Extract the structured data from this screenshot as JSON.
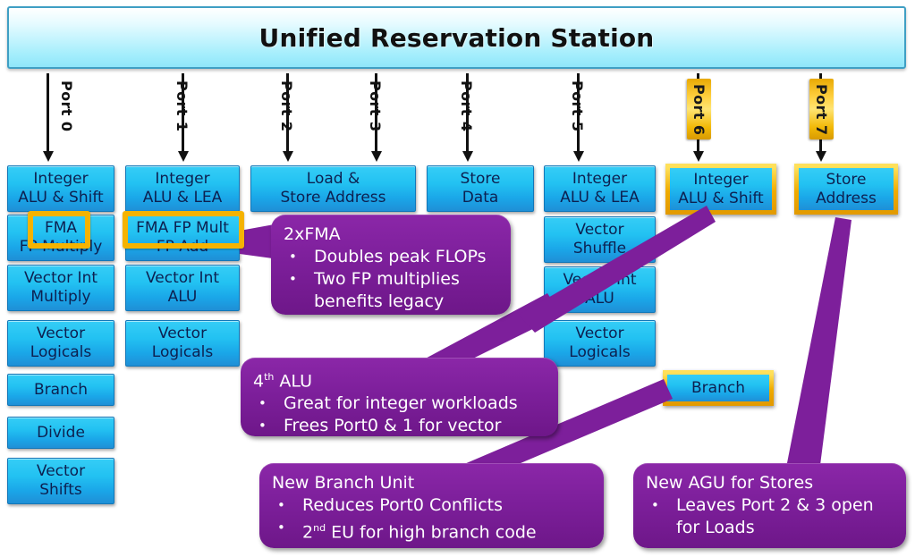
{
  "header": {
    "title": "Unified Reservation Station"
  },
  "ports": [
    {
      "label": "Port 0",
      "highlight": false
    },
    {
      "label": "Port 1",
      "highlight": false
    },
    {
      "label": "Port 2",
      "highlight": false
    },
    {
      "label": "Port 3",
      "highlight": false
    },
    {
      "label": "Port 4",
      "highlight": false
    },
    {
      "label": "Port 5",
      "highlight": false
    },
    {
      "label": "Port 6",
      "highlight": true
    },
    {
      "label": "Port 7",
      "highlight": true
    }
  ],
  "units": {
    "p0": [
      {
        "line1": "Integer",
        "line2": "ALU & Shift"
      },
      {
        "line1": "FMA",
        "line2": "FP Multiply"
      },
      {
        "line1": "Vector Int",
        "line2": "Multiply"
      },
      {
        "line1": "Vector",
        "line2": "Logicals"
      },
      {
        "line1": "Branch",
        "line2": ""
      },
      {
        "line1": "Divide",
        "line2": ""
      },
      {
        "line1": "Vector",
        "line2": "Shifts"
      }
    ],
    "p1": [
      {
        "line1": "Integer",
        "line2": "ALU & LEA"
      },
      {
        "line1": "FMA FP Mult",
        "line2": "FP Add"
      },
      {
        "line1": "Vector Int",
        "line2": "ALU"
      },
      {
        "line1": "Vector",
        "line2": "Logicals"
      }
    ],
    "p23": [
      {
        "line1": "Load &",
        "line2": "Store Address"
      }
    ],
    "p4": [
      {
        "line1": "Store",
        "line2": "Data"
      }
    ],
    "p5": [
      {
        "line1": "Integer",
        "line2": "ALU & LEA"
      },
      {
        "line1": "Vector",
        "line2": "Shuffle"
      },
      {
        "line1": "Vector Int",
        "line2": "ALU"
      },
      {
        "line1": "Vector",
        "line2": "Logicals"
      }
    ],
    "p6": [
      {
        "line1": "Integer",
        "line2": "ALU & Shift"
      },
      {
        "line1": "Branch",
        "line2": ""
      }
    ],
    "p7": [
      {
        "line1": "Store",
        "line2": "Address"
      }
    ]
  },
  "callouts": {
    "fma": {
      "title": "2xFMA",
      "bullets": [
        "Doubles peak FLOPs",
        "Two FP multiplies benefits legacy"
      ],
      "bullet_char": "•"
    },
    "alu": {
      "title_main": "4",
      "title_sup": "th",
      "title_rest": " ALU",
      "bullets": [
        "Great for integer workloads",
        "Frees Port0 & 1 for vector"
      ],
      "bullet_char": "•"
    },
    "branch": {
      "title": "New Branch Unit",
      "bullet1": "Reduces Port0 Conflicts",
      "bullet2_num": "2",
      "bullet2_sup": "nd",
      "bullet2_rest": " EU for high branch code",
      "bullet_char": "•"
    },
    "agu": {
      "title": "New AGU for Stores",
      "bullets": [
        "Leaves Port 2 & 3 open for Loads"
      ],
      "bullet_char": "•"
    }
  },
  "colors": {
    "header_border": "#3f9fc4",
    "unit_blue": "#23c2f2",
    "gold": "#f5b301",
    "callout_purple": "#7d1f9b",
    "arrow_black": "#111111"
  }
}
